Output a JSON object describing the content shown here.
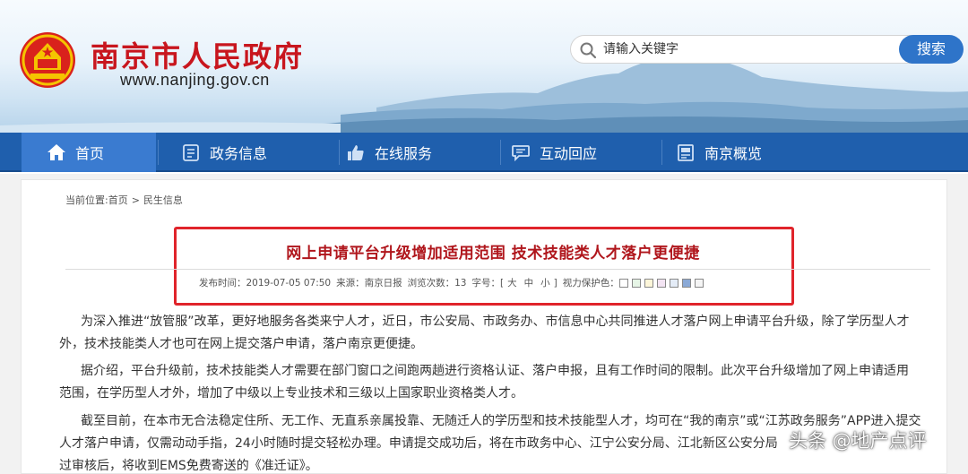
{
  "header": {
    "site_title": "南京市人民政府",
    "site_url": "www.nanjing.gov.cn",
    "search_placeholder": "请输入关键字",
    "search_button": "搜索"
  },
  "nav": {
    "items": [
      {
        "label": "首页",
        "icon": "home-icon",
        "active": true
      },
      {
        "label": "政务信息",
        "icon": "document-icon",
        "active": false
      },
      {
        "label": "在线服务",
        "icon": "thumbs-up-icon",
        "active": false
      },
      {
        "label": "互动回应",
        "icon": "chat-icon",
        "active": false
      },
      {
        "label": "南京概览",
        "icon": "info-panel-icon",
        "active": false
      }
    ]
  },
  "breadcrumb": {
    "prefix": "当前位置:",
    "home": "首页",
    "separator": ">",
    "current": "民生信息"
  },
  "article": {
    "title": "网上申请平台升级增加适用范围 技术技能类人才落户更便捷",
    "meta": {
      "publish_time": "发布时间：2019-07-05 07:50",
      "source": "来源：南京日报",
      "views": "浏览次数：13",
      "font_size_label": "字号：[",
      "font_sizes": [
        "大",
        "中",
        "小"
      ],
      "font_size_end": "]",
      "eye_protect_label": "视力保护色："
    },
    "swatch_colors": [
      "#ffffff",
      "#e6f5e6",
      "#fdf6d9",
      "#f3e4f3",
      "#e4ecf7",
      "#8aa9d6",
      "#f5f5f5"
    ],
    "paragraphs": [
      "为深入推进“放管服”改革，更好地服务各类来宁人才，近日，市公安局、市政务办、市信息中心共同推进人才落户网上申请平台升级，除了学历型人才",
      "外，技术技能类人才也可在网上提交落户申请，落户南京更便捷。",
      "据介绍，平台升级前，技术技能类人才需要在部门窗口之间跑两趟进行资格认证、落户申报，且有工作时间的限制。此次平台升级增加了网上申请适用",
      "范围，在学历型人才外，增加了中级以上专业技术和三级以上国家职业资格类人才。",
      "截至目前，在本市无合法稳定住所、无工作、无直系亲属投靠、无随迁人的学历型和技术技能型人才，均可在“我的南京”或“江苏政务服务”APP进入提交",
      "人才落户申请，仅需动动手指，24小时随时提交轻松办理。申请提交成功后，将在市政务中心、江宁公安分局、江北新区公安分局",
      "过审核后，将收到EMS免费寄送的《准迁证》。"
    ]
  },
  "watermark": "头条 @地产点评",
  "colors": {
    "brand_red": "#c8161e",
    "nav_blue": "#1f5fad",
    "nav_active": "#3a7bd0",
    "search_button": "#2e74c9",
    "headline_border": "#e0242b"
  }
}
